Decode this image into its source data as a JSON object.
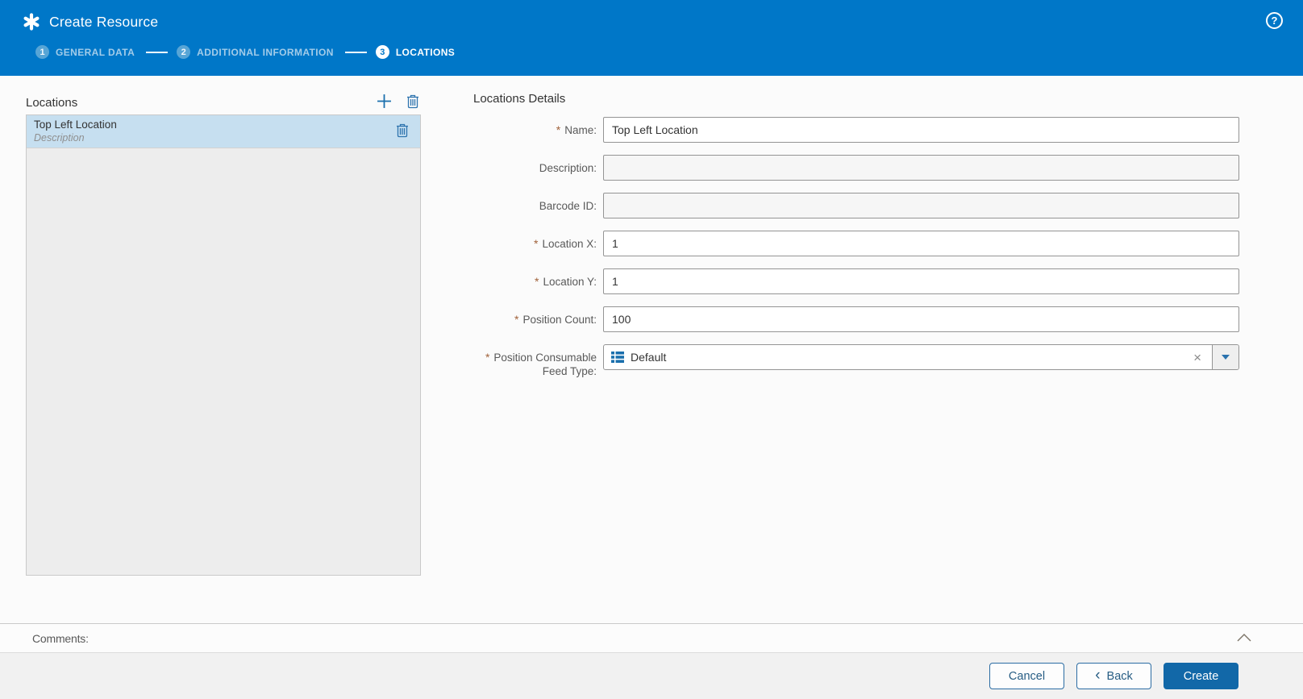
{
  "header": {
    "title": "Create Resource",
    "help_glyph": "?",
    "steps": [
      {
        "number": "1",
        "label": "GENERAL DATA"
      },
      {
        "number": "2",
        "label": "ADDITIONAL INFORMATION"
      },
      {
        "number": "3",
        "label": "LOCATIONS"
      }
    ]
  },
  "locations_panel": {
    "title": "Locations",
    "items": [
      {
        "name": "Top Left Location",
        "description": "Description"
      }
    ]
  },
  "details": {
    "title": "Locations Details",
    "required_marker": "*",
    "fields": [
      {
        "label": "Name:",
        "required": true,
        "value": "Top Left Location"
      },
      {
        "label": "Description:",
        "required": false,
        "value": ""
      },
      {
        "label": "Barcode ID:",
        "required": false,
        "value": ""
      },
      {
        "label": "Location X:",
        "required": true,
        "value": "1"
      },
      {
        "label": "Location Y:",
        "required": true,
        "value": "1"
      },
      {
        "label": "Position Count:",
        "required": true,
        "value": "100"
      },
      {
        "label": "Position Consumable Feed Type:",
        "required": true,
        "value": "Default",
        "type": "combobox",
        "clear_glyph": "×"
      }
    ]
  },
  "comments": {
    "label": "Comments:"
  },
  "footer": {
    "cancel_label": "Cancel",
    "back_chevron": "‹",
    "back_label": "Back",
    "create_label": "Create"
  },
  "colors": {
    "header_blue": "#0077c8",
    "accent_blue": "#1a6fad",
    "create_button_blue": "#1268a8",
    "selected_item_blue": "#c6dff0",
    "required_asterisk": "#a0613a"
  }
}
